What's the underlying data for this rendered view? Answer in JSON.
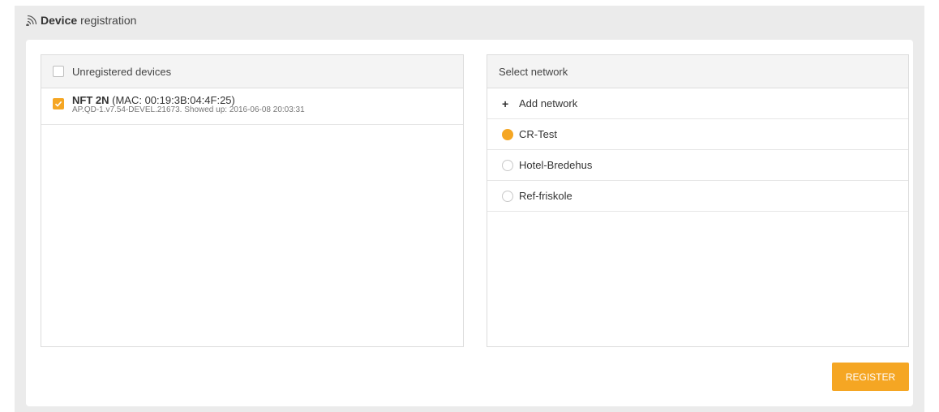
{
  "header": {
    "title_bold": "Device",
    "title_rest": "registration"
  },
  "devices": {
    "header_label": "Unregistered devices",
    "items": [
      {
        "name": "NFT 2N",
        "mac": "(MAC: 00:19:3B:04:4F:25)",
        "detail": "AP.QD-1.v7.54-DEVEL.21673. Showed up: 2016-06-08 20:03:31",
        "checked": true
      }
    ]
  },
  "networks": {
    "header_label": "Select network",
    "add_label": "Add network",
    "items": [
      {
        "label": "CR-Test",
        "selected": true
      },
      {
        "label": "Hotel-Bredehus",
        "selected": false
      },
      {
        "label": "Ref-friskole",
        "selected": false
      }
    ]
  },
  "actions": {
    "register_label": "REGISTER"
  },
  "colors": {
    "accent": "#f5a623",
    "background": "#ebebeb"
  },
  "icons": {
    "title": "wifi-icon",
    "checked": "checkmark-icon",
    "add": "plus-icon"
  }
}
